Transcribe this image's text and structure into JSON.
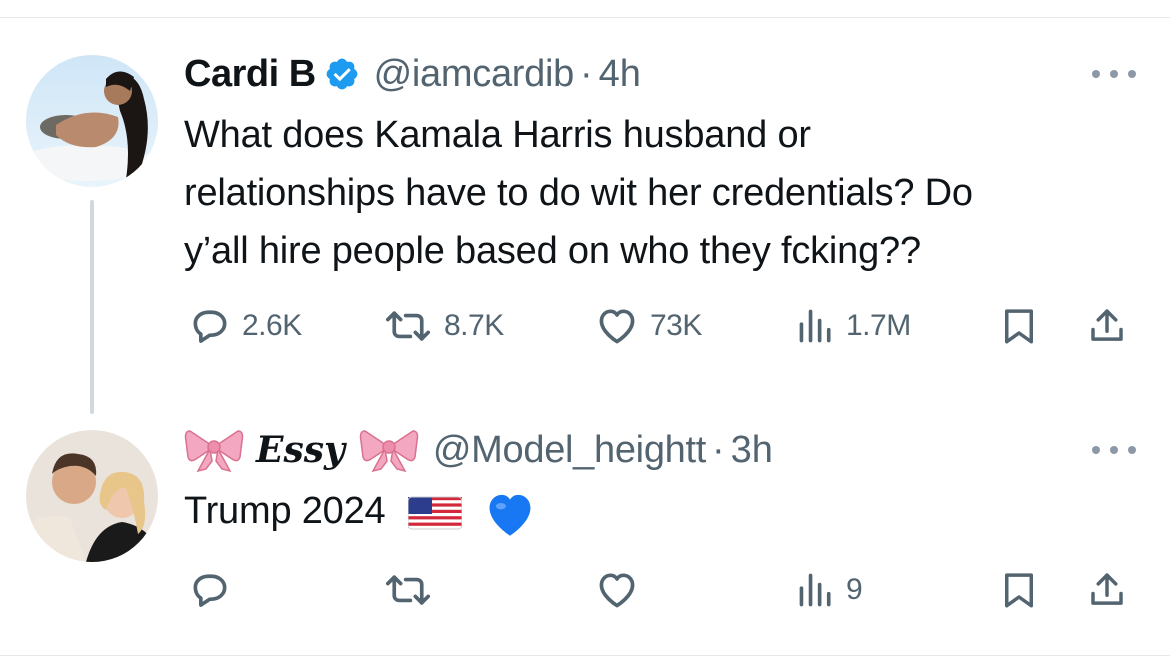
{
  "tweet1": {
    "display_name": "Cardi B",
    "handle": "@iamcardib",
    "separator": "·",
    "time": "4h",
    "text_lines": [
      "What does Kamala Harris husband or",
      "relationships have to do wit her credentials? Do",
      "y’all hire people based on who they fcking??"
    ],
    "stats": {
      "replies": "2.6K",
      "retweets": "8.7K",
      "likes": "73K",
      "views": "1.7M"
    }
  },
  "tweet2": {
    "display_name": "Essy",
    "handle": "@Model_heightt",
    "separator": "·",
    "time": "3h",
    "text": "Trump 2024",
    "stats": {
      "views": "9"
    }
  },
  "colors": {
    "text": "#0f1419",
    "muted": "#536471",
    "verified": "#1d9bf0",
    "thread_line": "#cfd9de",
    "bow": "#f4a7c0",
    "heart_blue": "#1877f2"
  },
  "icons": [
    "reply-icon",
    "retweet-icon",
    "like-icon",
    "views-icon",
    "bookmark-icon",
    "share-icon",
    "more-icon",
    "verified-icon"
  ]
}
